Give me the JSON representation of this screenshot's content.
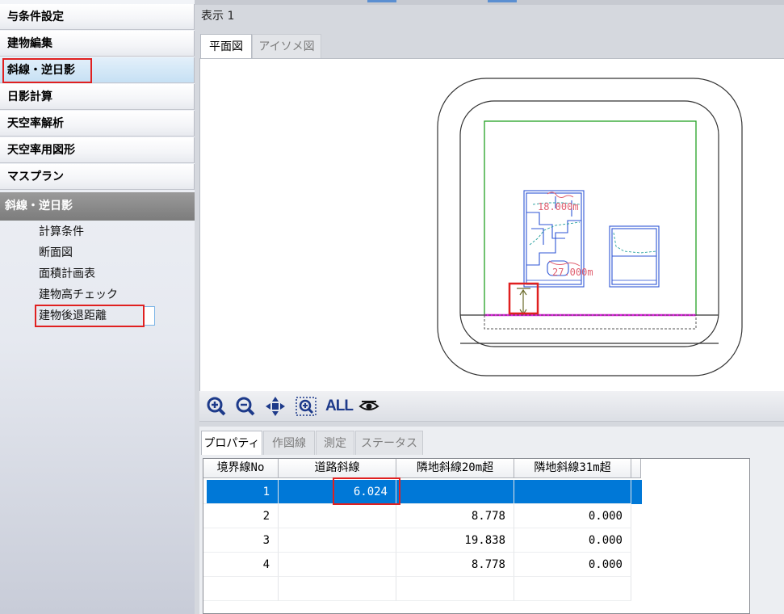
{
  "sidebar": {
    "nav": [
      {
        "label": "与条件設定"
      },
      {
        "label": "建物編集"
      },
      {
        "label": "斜線・逆日影"
      },
      {
        "label": "日影計算"
      },
      {
        "label": "天空率解析"
      },
      {
        "label": "天空率用図形"
      },
      {
        "label": "マスプラン"
      }
    ],
    "section_title": "斜線・逆日影",
    "sub_items": [
      {
        "label": "計算条件"
      },
      {
        "label": "断面図"
      },
      {
        "label": "面積計画表"
      },
      {
        "label": "建物高チェック"
      },
      {
        "label": "建物後退距離"
      }
    ]
  },
  "view": {
    "title": "表示 1",
    "tabs": [
      {
        "label": "平面図"
      },
      {
        "label": "アイソメ図"
      }
    ],
    "plan_labels": {
      "upper": "18.000m",
      "lower": "27.000m"
    },
    "toolbar": {
      "all_label": "ALL"
    }
  },
  "panel": {
    "tabs": [
      {
        "label": "プロパティ"
      },
      {
        "label": "作図線"
      },
      {
        "label": "測定"
      },
      {
        "label": "ステータス"
      }
    ],
    "columns": [
      "境界線No",
      "道路斜線",
      "隣地斜線20m超",
      "隣地斜線31m超"
    ],
    "rows": [
      {
        "no": "1",
        "road": "6.024",
        "adj20": "",
        "adj31": ""
      },
      {
        "no": "2",
        "road": "",
        "adj20": "8.778",
        "adj31": "0.000"
      },
      {
        "no": "3",
        "road": "",
        "adj20": "19.838",
        "adj31": "0.000"
      },
      {
        "no": "4",
        "road": "",
        "adj20": "8.778",
        "adj31": "0.000"
      }
    ]
  },
  "colors": {
    "highlight": "#e02020",
    "selection": "#0078d7",
    "site": "#22a022",
    "road_line": "#e020e0",
    "building": "#2f56d6",
    "annotation": "#e06070"
  }
}
